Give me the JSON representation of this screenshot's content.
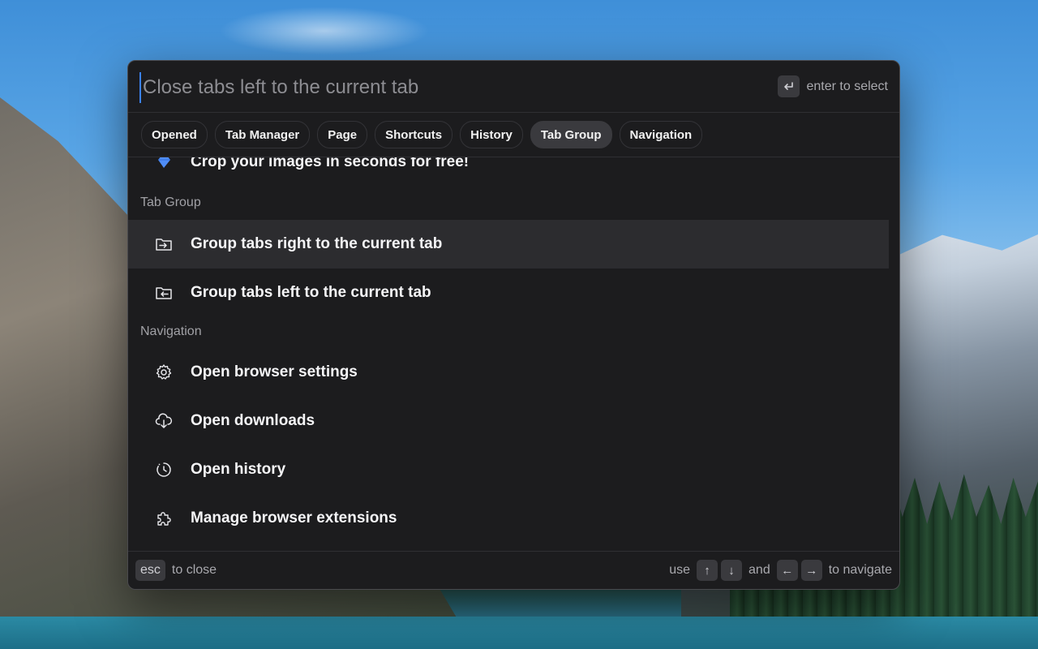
{
  "search": {
    "placeholder": "Close tabs left to the current tab",
    "enter_hint": "enter to select"
  },
  "tabs": [
    {
      "label": "Opened"
    },
    {
      "label": "Tab Manager"
    },
    {
      "label": "Page"
    },
    {
      "label": "Shortcuts"
    },
    {
      "label": "History"
    },
    {
      "label": "Tab Group",
      "active": true
    },
    {
      "label": "Navigation"
    }
  ],
  "results": {
    "promo": {
      "label": "Crop your images in seconds for free!",
      "icon": "diamond-icon"
    },
    "sections": [
      {
        "title": "Tab Group",
        "items": [
          {
            "label": "Group tabs right to the current tab",
            "icon": "folder-arrow-right-icon",
            "selected": true
          },
          {
            "label": "Group tabs left to the current tab",
            "icon": "folder-arrow-left-icon"
          }
        ]
      },
      {
        "title": "Navigation",
        "items": [
          {
            "label": "Open browser settings",
            "icon": "gear-icon"
          },
          {
            "label": "Open downloads",
            "icon": "cloud-download-icon"
          },
          {
            "label": "Open history",
            "icon": "clock-history-icon"
          },
          {
            "label": "Manage browser extensions",
            "icon": "puzzle-icon"
          }
        ]
      }
    ]
  },
  "footer": {
    "esc_key": "esc",
    "close_text": "to close",
    "use_text": "use",
    "arrow_up": "↑",
    "arrow_down": "↓",
    "and_text": "and",
    "arrow_left": "←",
    "arrow_right": "→",
    "navigate_text": "to navigate"
  },
  "colors": {
    "panel_bg": "#1c1c1e",
    "selected_bg": "#2c2c2f",
    "accent": "#3b82f6",
    "promo_icon": "#4f8df7"
  }
}
